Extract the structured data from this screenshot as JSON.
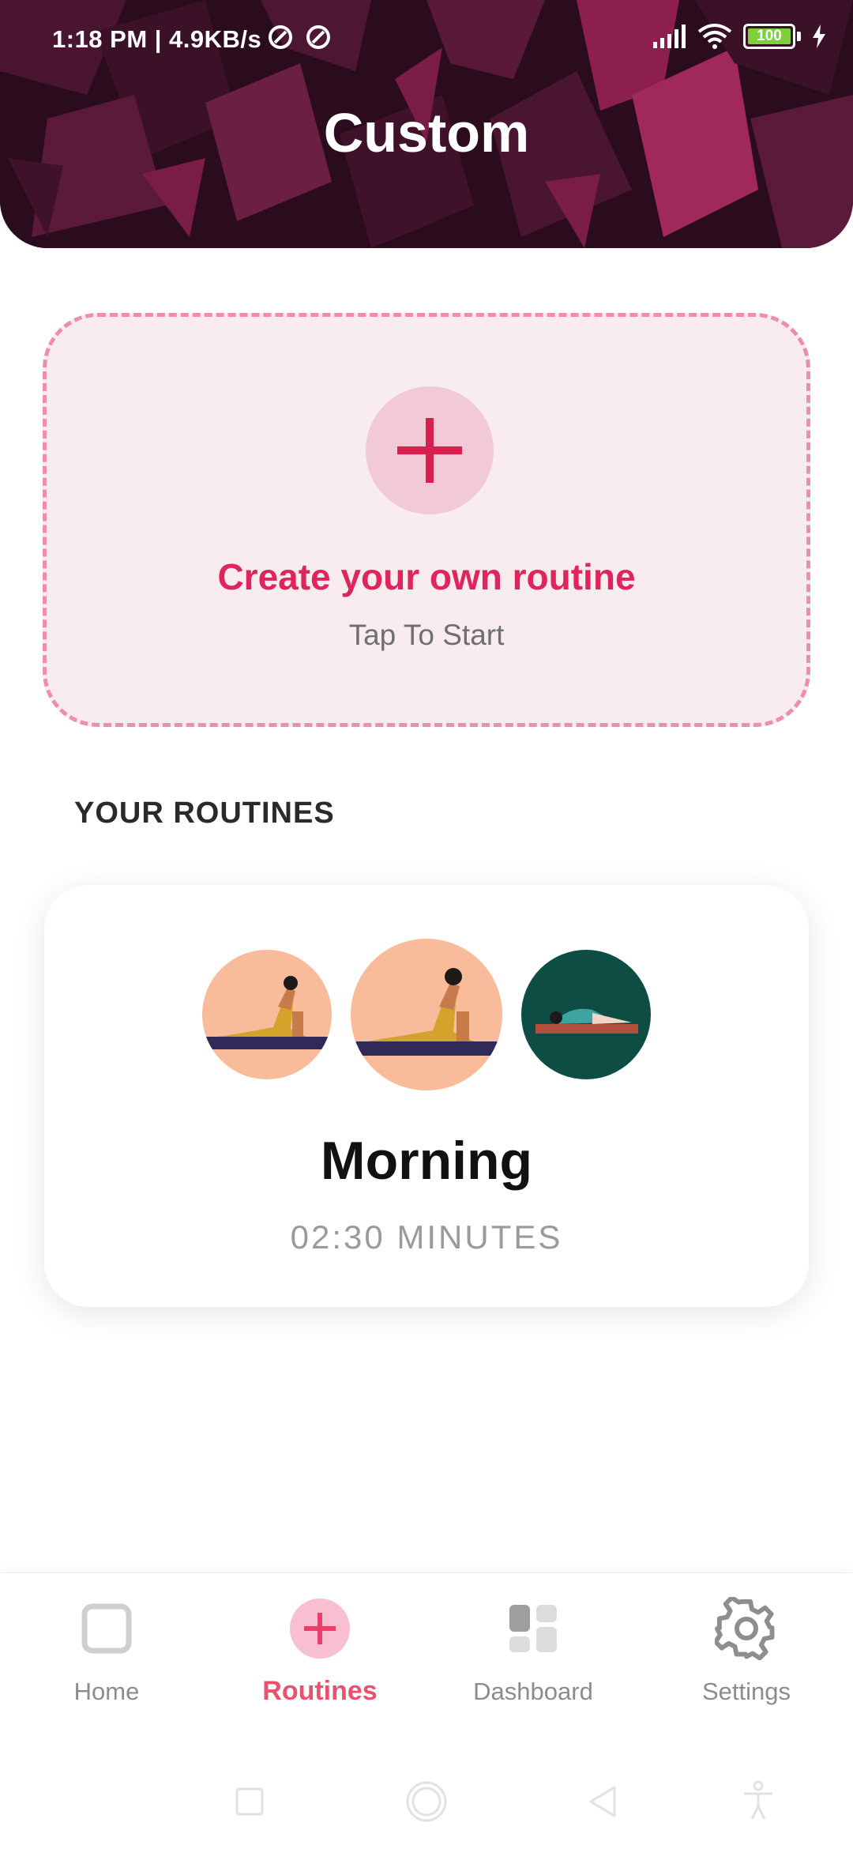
{
  "status_bar": {
    "time": "1:18 PM | 4.9KB/s",
    "battery": "100"
  },
  "header": {
    "title": "Custom"
  },
  "create_card": {
    "title": "Create your own routine",
    "subtitle": "Tap To Start"
  },
  "section": {
    "title": "YOUR ROUTINES"
  },
  "routines": [
    {
      "name": "Morning",
      "duration": "02:30 MINUTES"
    }
  ],
  "bottom_nav": {
    "items": [
      {
        "label": "Home",
        "icon": "square-icon",
        "active": false
      },
      {
        "label": "Routines",
        "icon": "plus-icon",
        "active": true
      },
      {
        "label": "Dashboard",
        "icon": "dashboard-icon",
        "active": false
      },
      {
        "label": "Settings",
        "icon": "gear-icon",
        "active": false
      }
    ]
  },
  "colors": {
    "accent": "#e0245e",
    "nav_active": "#ea5170",
    "header_bg": "#2a0b1c",
    "card_bg": "#f8ecef",
    "card_border": "#ee8db0"
  }
}
